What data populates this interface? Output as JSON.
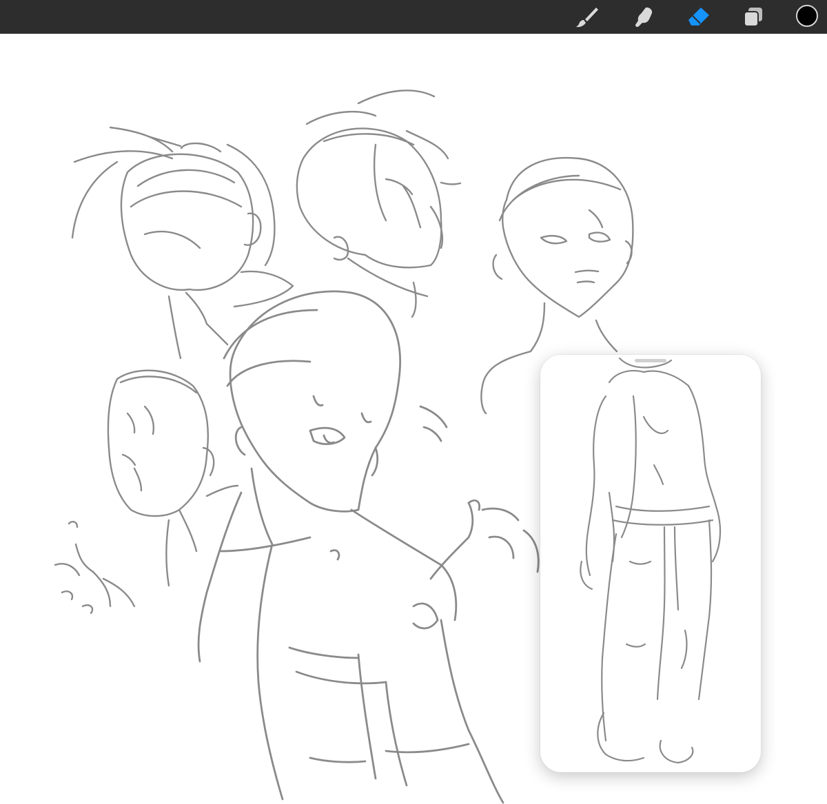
{
  "toolbar": {
    "tools": [
      {
        "name": "brush-tool",
        "icon": "paintbrush-icon",
        "active": false
      },
      {
        "name": "smudge-tool",
        "icon": "smudge-finger-icon",
        "active": false
      },
      {
        "name": "eraser-tool",
        "icon": "eraser-icon",
        "active": true
      },
      {
        "name": "layers-tool",
        "icon": "layers-icon",
        "active": false
      }
    ],
    "active_color": "#1593ff",
    "inactive_color": "#d9d9d9",
    "current_color": "#000000"
  },
  "canvas": {
    "background": "#ffffff",
    "stroke_color": "#8a8a8a"
  },
  "reference_window": {
    "visible": true,
    "background": "#ffffff"
  }
}
